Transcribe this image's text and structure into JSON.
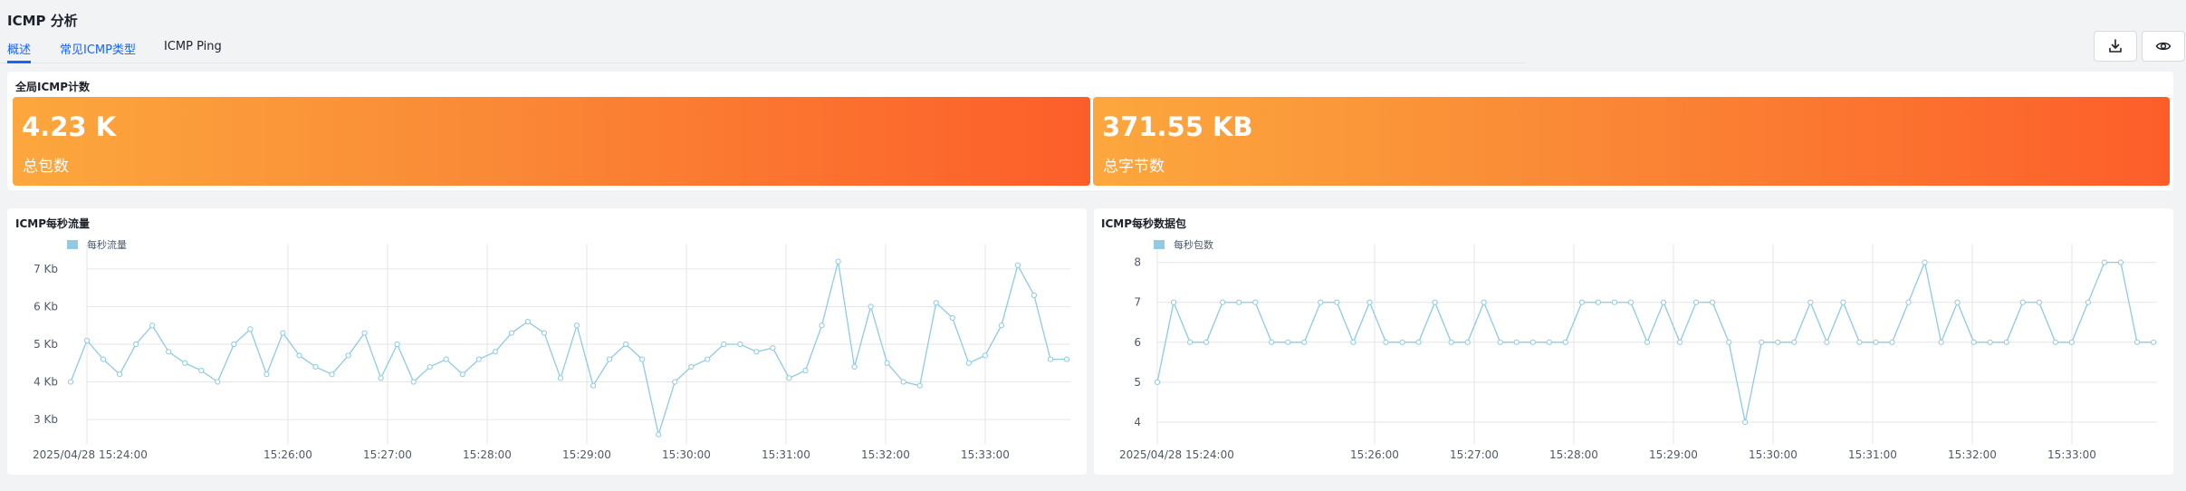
{
  "header": {
    "title": "ICMP 分析",
    "tabs": [
      {
        "label": "概述",
        "active": true
      },
      {
        "label": "常见ICMP类型",
        "active": false
      },
      {
        "label": "ICMP Ping",
        "active": false
      }
    ],
    "actions": {
      "download_icon": "download-icon",
      "view_icon": "eye-icon"
    }
  },
  "global_counts": {
    "title": "全局ICMP计数",
    "stats": [
      {
        "value": "4.23 K",
        "label": "总包数"
      },
      {
        "value": "371.55 KB",
        "label": "总字节数"
      }
    ]
  },
  "colors": {
    "accent": "#1664ff",
    "stat_gradient_start": "#fca73d",
    "stat_gradient_end": "#fd5e29",
    "series_line": "#8fcbe3",
    "grid": "#e5e6eb"
  },
  "chart_data": [
    {
      "type": "line",
      "title": "ICMP每秒流量",
      "legend_position": "top-left",
      "grid": true,
      "x_tick_labels": [
        "2025/04/28 15:24:00",
        "15:26:00",
        "15:27:00",
        "15:28:00",
        "15:29:00",
        "15:30:00",
        "15:31:00",
        "15:32:00",
        "15:33:00"
      ],
      "y_tick_labels": [
        "3 Kb",
        "4 Kb",
        "5 Kb",
        "6 Kb",
        "7 Kb"
      ],
      "y_ticks": [
        3,
        4,
        5,
        6,
        7
      ],
      "ylim": [
        2.4,
        7.6
      ],
      "xlim": [
        0,
        61
      ],
      "x_ticks": [
        0,
        20,
        28,
        36,
        44,
        52,
        60,
        68,
        76
      ],
      "x_tick_index_note": "",
      "series": [
        {
          "name": "每秒流量",
          "values": [
            4.0,
            5.1,
            4.6,
            4.2,
            5.0,
            5.5,
            4.8,
            4.5,
            4.3,
            4.0,
            5.0,
            5.4,
            4.2,
            5.3,
            4.7,
            4.4,
            4.2,
            4.7,
            5.3,
            4.1,
            5.0,
            4.0,
            4.4,
            4.6,
            4.2,
            4.6,
            4.8,
            5.3,
            5.6,
            5.3,
            4.1,
            5.5,
            3.9,
            4.6,
            5.0,
            4.6,
            2.6,
            4.0,
            4.4,
            4.6,
            5.0,
            5.0,
            4.8,
            4.9,
            4.1,
            4.3,
            5.5,
            7.2,
            4.4,
            6.0,
            4.5,
            4.0,
            3.9,
            6.1,
            5.7,
            4.5,
            4.7,
            5.5,
            7.1,
            6.3,
            4.6,
            4.6
          ]
        }
      ]
    },
    {
      "type": "line",
      "title": "ICMP每秒数据包",
      "legend_position": "top-left",
      "grid": true,
      "x_tick_labels": [
        "2025/04/28 15:24:00",
        "15:26:00",
        "15:27:00",
        "15:28:00",
        "15:29:00",
        "15:30:00",
        "15:31:00",
        "15:32:00",
        "15:33:00"
      ],
      "y_tick_labels": [
        "4",
        "5",
        "6",
        "7",
        "8"
      ],
      "y_ticks": [
        4,
        5,
        6,
        7,
        8
      ],
      "ylim": [
        3.5,
        8.4
      ],
      "series": [
        {
          "name": "每秒包数",
          "values": [
            5,
            7,
            6,
            6,
            7,
            7,
            7,
            6,
            6,
            6,
            7,
            7,
            6,
            7,
            6,
            6,
            6,
            7,
            6,
            6,
            7,
            6,
            6,
            6,
            6,
            6,
            7,
            7,
            7,
            7,
            6,
            7,
            6,
            7,
            7,
            6,
            4,
            6,
            6,
            6,
            7,
            6,
            7,
            6,
            6,
            6,
            7,
            8,
            6,
            7,
            6,
            6,
            6,
            7,
            7,
            6,
            6,
            7,
            8,
            8,
            6,
            6
          ]
        }
      ]
    }
  ]
}
